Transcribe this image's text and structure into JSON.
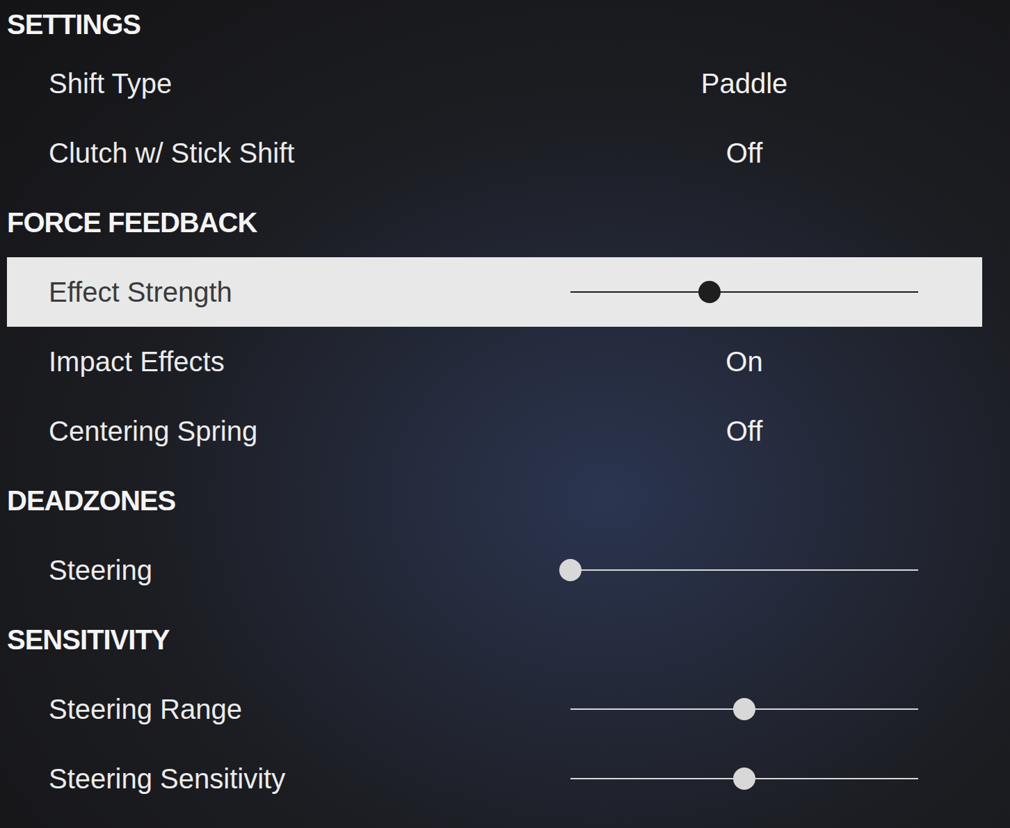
{
  "sections": [
    {
      "title": "SETTINGS",
      "items": [
        {
          "label": "Shift Type",
          "kind": "value",
          "value": "Paddle",
          "selected": false
        },
        {
          "label": "Clutch w/ Stick Shift",
          "kind": "value",
          "value": "Off",
          "selected": false
        }
      ]
    },
    {
      "title": "FORCE FEEDBACK",
      "items": [
        {
          "label": "Effect Strength",
          "kind": "slider",
          "level": 0.4,
          "selected": true
        },
        {
          "label": "Impact Effects",
          "kind": "value",
          "value": "On",
          "selected": false
        },
        {
          "label": "Centering Spring",
          "kind": "value",
          "value": "Off",
          "selected": false
        }
      ]
    },
    {
      "title": "DEADZONES",
      "items": [
        {
          "label": "Steering",
          "kind": "slider",
          "level": 0.0,
          "selected": false
        }
      ]
    },
    {
      "title": "SENSITIVITY",
      "items": [
        {
          "label": "Steering Range",
          "kind": "slider",
          "level": 0.5,
          "selected": false
        },
        {
          "label": "Steering Sensitivity",
          "kind": "slider",
          "level": 0.5,
          "selected": false
        }
      ]
    }
  ]
}
